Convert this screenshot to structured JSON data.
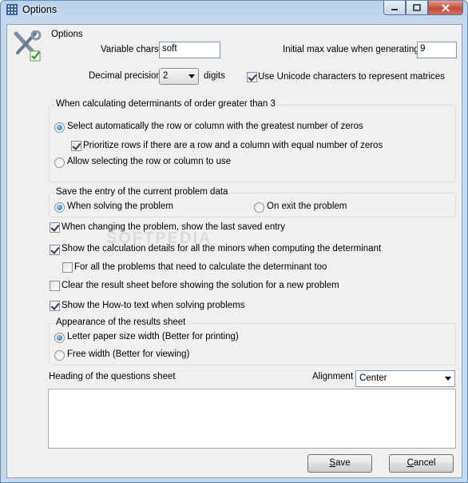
{
  "window": {
    "title": "Options"
  },
  "header": {
    "section_label": "Options",
    "variable_chars_label": "Variable chars",
    "variable_chars_value": "soft",
    "initial_max_label": "Initial max value when generating",
    "initial_max_value": "9",
    "decimal_precision_label": "Decimal precision",
    "decimal_precision_value": "2",
    "digits_label": "digits",
    "unicode_label": "Use Unicode characters to represent matrices",
    "unicode_checked": true
  },
  "determinants": {
    "title": "When calculating determinants of order greater than 3",
    "auto_select_label": "Select automatically the row or column with the greatest number of zeros",
    "prioritize_rows_label": "Prioritize rows if there are a row and a column with equal number of zeros",
    "allow_select_label": "Allow selecting the row or column to use"
  },
  "save_entry": {
    "title": "Save the entry of the current problem data",
    "when_solving_label": "When solving the problem",
    "on_exit_label": "On exit the problem"
  },
  "options": {
    "show_last_saved_label": "When changing the problem, show the last saved entry",
    "show_calc_details_label": "Show the calculation details for all the minors when computing the determinant",
    "all_problems_label": "For all the problems that need to calculate the determinant too",
    "clear_result_label": "Clear the result sheet before showing the solution for a new problem",
    "show_howto_label": "Show the How-to text when solving problems"
  },
  "appearance": {
    "title": "Appearance of the results sheet",
    "letter_label": "Letter paper size width (Better for printing)",
    "free_width_label": "Free width (Better for viewing)"
  },
  "heading": {
    "label": "Heading of the questions sheet",
    "alignment_label": "Alignment",
    "alignment_value": "Center"
  },
  "buttons": {
    "save_mnemonic": "S",
    "save_rest": "ave",
    "cancel_mnemonic": "C",
    "cancel_rest": "ancel"
  },
  "watermark": {
    "text": "SOFTPEDIA"
  },
  "icons": {
    "app_icon": "grid-icon",
    "options_icon": "tools-check-icon"
  },
  "colors": {
    "titlebar": "#b9d1ea",
    "dialog_bg": "#f0f0f0",
    "close_red": "#c54a37",
    "radio_blue": "#1e63b0"
  }
}
